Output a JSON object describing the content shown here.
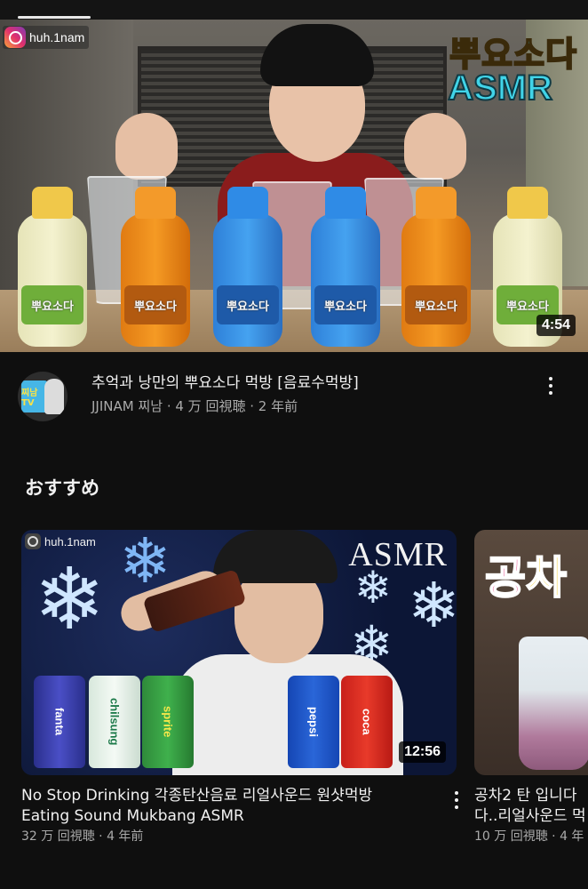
{
  "main_video": {
    "instagram_handle": "huh.1nam",
    "overlay_title": {
      "part1": "뿌요",
      "part2": "소",
      "part3": "다"
    },
    "overlay_subtitle": "ASMR",
    "duration": "4:54",
    "title": "추억과 낭만의 뿌요소다 먹방 [음료수먹방]",
    "meta": "JJINAM 찌남 · 4 万 回視聴 · 2 年前",
    "avatar_text": "찌남TV",
    "bottle_label": "뿌요소다"
  },
  "section": {
    "heading": "おすすめ"
  },
  "recommended": [
    {
      "instagram_handle": "huh.1nam",
      "overlay_text": "ASMR",
      "duration": "12:56",
      "title_line1": "No Stop Drinking 각종탄산음료 리얼사운드 원샷먹방",
      "title_line2": "Eating Sound Mukbang ASMR",
      "meta": "32 万 回視聴 · 4 年前",
      "cans": [
        "fanta",
        "chilsung",
        "sprite",
        "pepsi",
        "coca"
      ]
    },
    {
      "overlay_text": {
        "a": "공",
        "b": "차"
      },
      "title_line1": "공차2 탄 입니다",
      "title_line2": "다..리얼사운드 먹",
      "meta": "10 万 回視聴 · 4 年"
    }
  ],
  "colors": {
    "background": "#0f0f0f",
    "text_primary": "#f1f1f1",
    "text_secondary": "#aaaaaa"
  }
}
